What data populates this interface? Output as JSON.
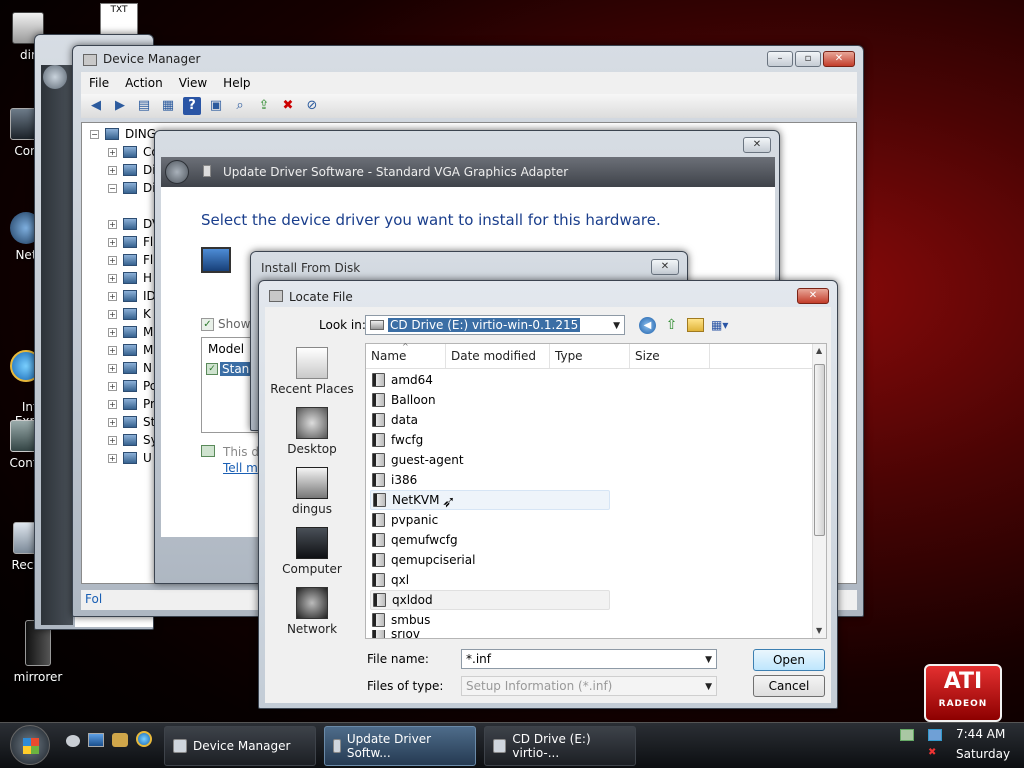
{
  "desktop": {
    "icons": [
      "dir",
      "Con",
      "Net",
      "Int\nExp",
      "Contr",
      "Recy",
      "mirrorer"
    ],
    "txt_label": "TXT"
  },
  "device_manager": {
    "title": "Device Manager",
    "menu": [
      "File",
      "Action",
      "View",
      "Help"
    ],
    "tree_root": "DING",
    "tree_items": [
      "Co",
      "Di",
      "Di",
      "DV",
      "Fl",
      "Fl",
      "H",
      "ID",
      "K",
      "M",
      "M",
      "N",
      "Po",
      "Pr",
      "St",
      "Sy",
      "U"
    ],
    "status_left": "Fol"
  },
  "update_driver": {
    "title": "Update Driver Software - Standard VGA Graphics Adapter",
    "heading": "Select the device driver you want to install for this hardware.",
    "show_compatible": "Show c",
    "model_header": "Model",
    "model_item": "Stand",
    "info_text": "This d",
    "link_text": "Tell m"
  },
  "install_from_disk": {
    "title": "Install From Disk"
  },
  "locate_file": {
    "title": "Locate File",
    "look_in_label": "Look in:",
    "look_in_value": "CD Drive (E:) virtio-win-0.1.215",
    "places": [
      "Recent Places",
      "Desktop",
      "dingus",
      "Computer",
      "Network"
    ],
    "columns": [
      "Name",
      "Date modified",
      "Type",
      "Size"
    ],
    "files": [
      "amd64",
      "Balloon",
      "data",
      "fwcfg",
      "guest-agent",
      "i386",
      "NetKVM",
      "pvpanic",
      "qemufwcfg",
      "qemupciserial",
      "qxl",
      "qxldod",
      "smbus",
      "sriov"
    ],
    "file_name_label": "File name:",
    "file_name_value": "*.inf",
    "file_type_label": "Files of type:",
    "file_type_value": "Setup Information (*.inf)",
    "open_label": "Open",
    "cancel_label": "Cancel"
  },
  "taskbar": {
    "tasks": [
      "Device Manager",
      "Update Driver Softw...",
      "CD Drive (E:) virtio-..."
    ],
    "time": "7:44 AM",
    "day": "Saturday"
  },
  "ati_logo": "ATI RADEON"
}
